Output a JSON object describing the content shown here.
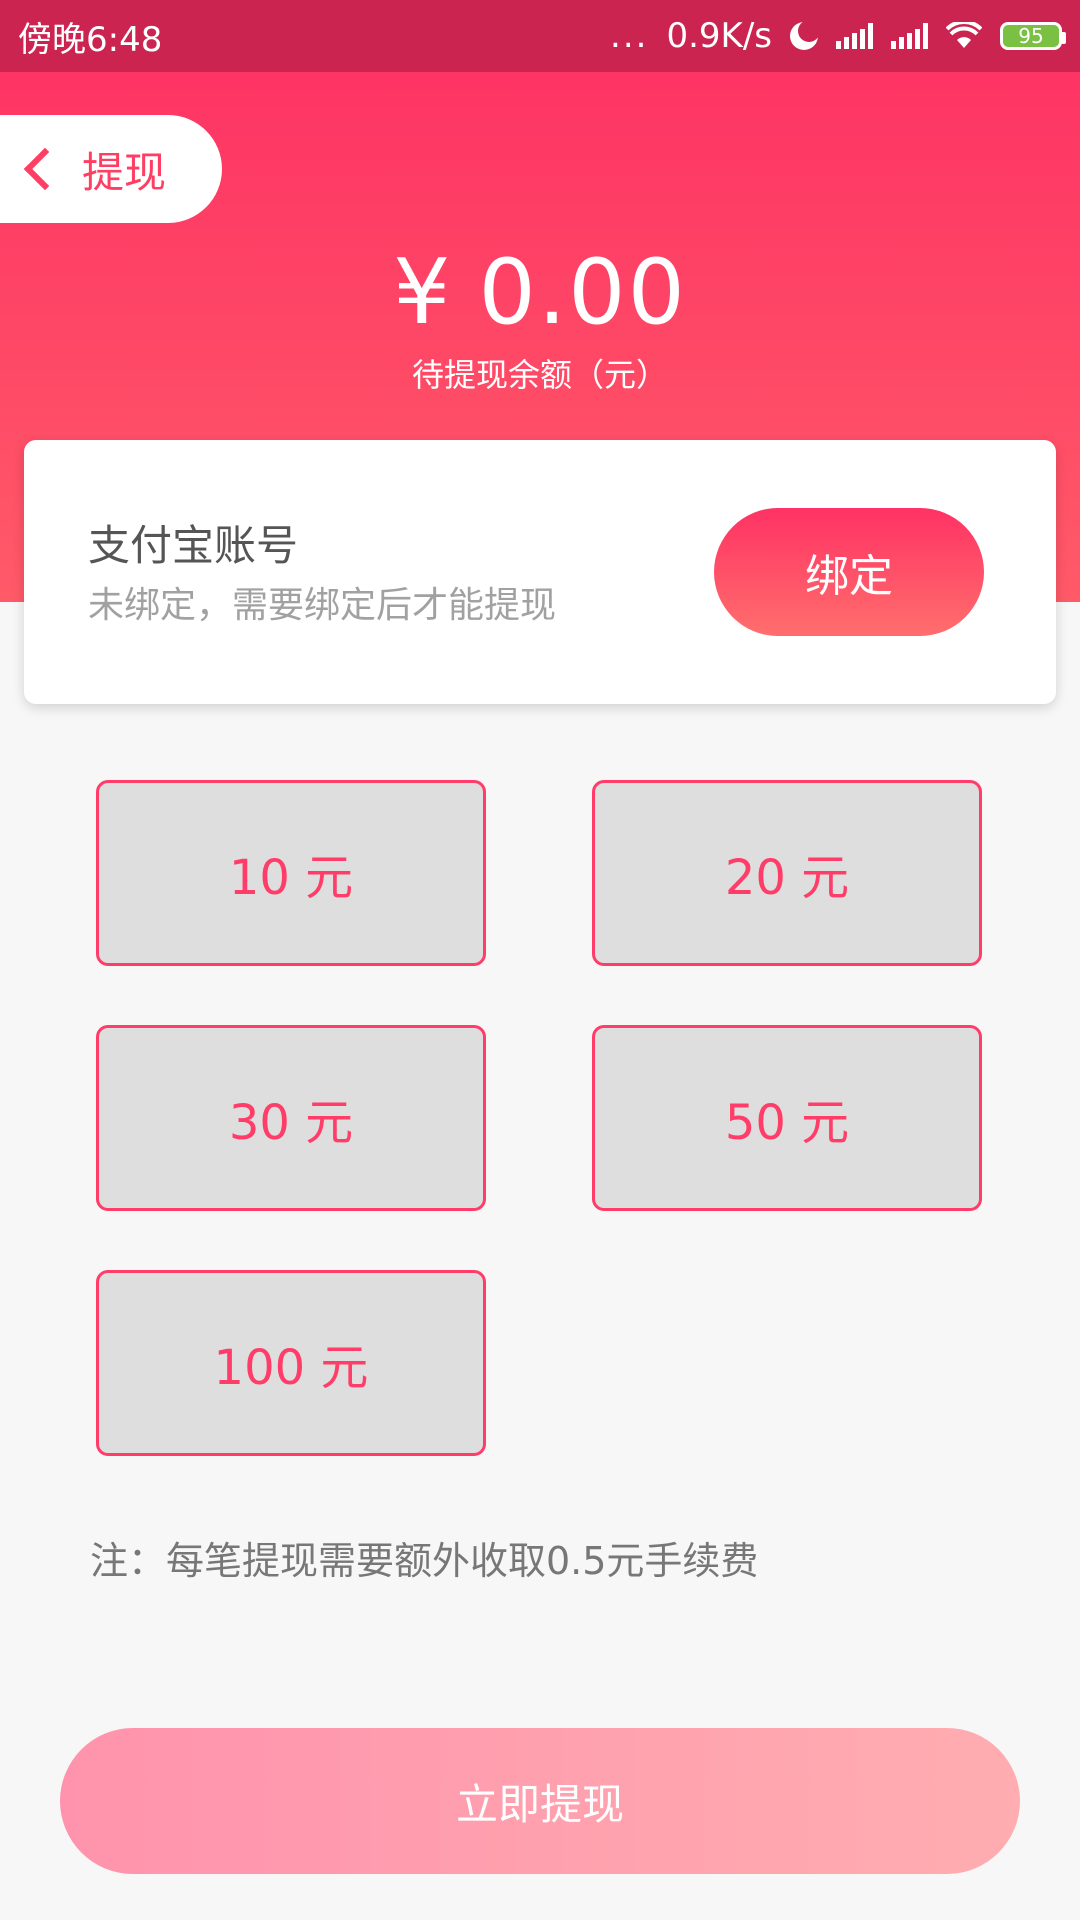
{
  "status_bar": {
    "time": "傍晚6:48",
    "dots": "...",
    "speed": "0.9K/s",
    "battery": "95",
    "battery_color": "#7ac143"
  },
  "header": {
    "back_label": "提现",
    "back_icon": "chevron-left-icon"
  },
  "balance": {
    "currency": "¥",
    "amount": "0.00",
    "caption": "待提现余额（元）"
  },
  "alipay": {
    "title": "支付宝账号",
    "subtitle": "未绑定，需要绑定后才能提现",
    "bind_label": "绑定"
  },
  "options": [
    {
      "label": "10 元"
    },
    {
      "label": "20 元"
    },
    {
      "label": "30 元"
    },
    {
      "label": "50 元"
    },
    {
      "label": "100 元"
    }
  ],
  "note": "注：每笔提现需要额外收取0.5元手续费",
  "withdraw_label": "立即提现",
  "colors": {
    "accent": "#fe3464",
    "status_bar": "#cc2451",
    "option_bg": "#dedede",
    "option_border": "#ff3d68"
  }
}
